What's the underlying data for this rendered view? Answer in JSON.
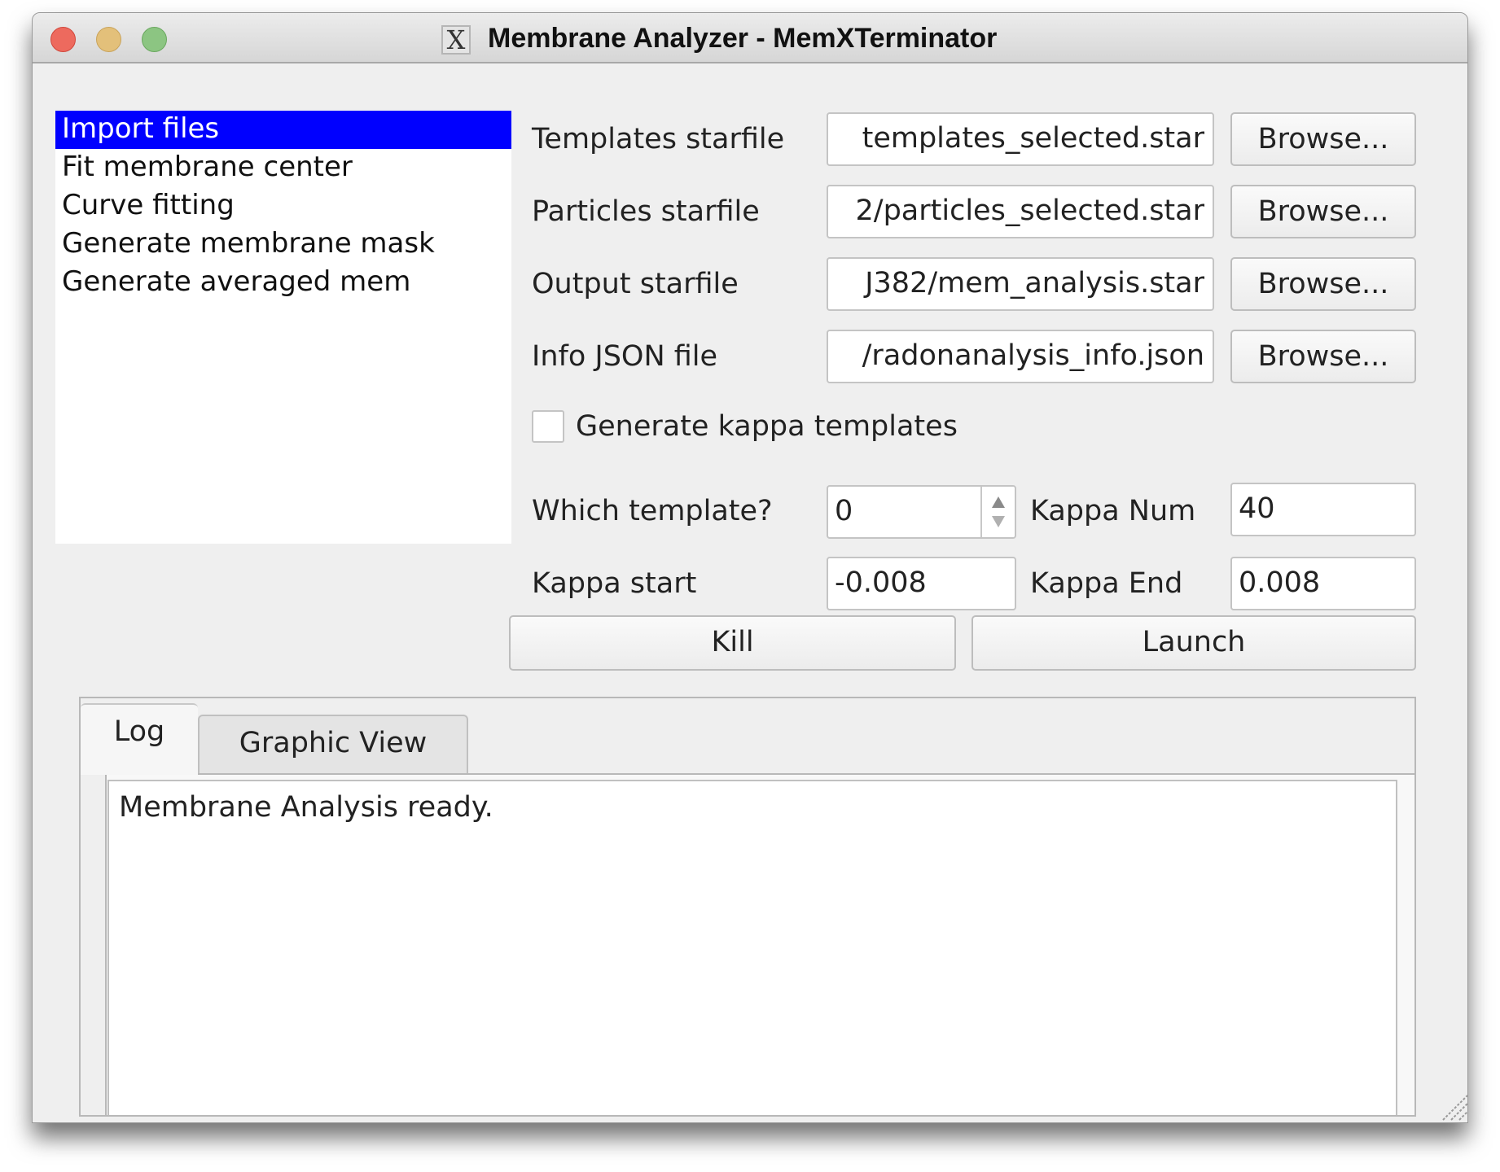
{
  "window": {
    "title": "Membrane Analyzer - MemXTerminator",
    "app_icon": "x11-icon",
    "controls": [
      "close",
      "minimize",
      "maximize"
    ]
  },
  "steps": {
    "items": [
      {
        "label": "Import files",
        "selected": true
      },
      {
        "label": "Fit membrane center",
        "selected": false
      },
      {
        "label": "Curve fitting",
        "selected": false
      },
      {
        "label": "Generate membrane mask",
        "selected": false
      },
      {
        "label": "Generate averaged mem",
        "selected": false
      }
    ]
  },
  "form": {
    "file_rows": [
      {
        "label": "Templates starfile",
        "value": "templates_selected.star",
        "button": "Browse..."
      },
      {
        "label": "Particles starfile",
        "value": "2/particles_selected.star",
        "button": "Browse..."
      },
      {
        "label": "Output starfile",
        "value": "J382/mem_analysis.star",
        "button": "Browse..."
      },
      {
        "label": "Info JSON file",
        "value": "/radonanalysis_info.json",
        "button": "Browse..."
      }
    ],
    "generate_kappa": {
      "label": "Generate kappa templates",
      "checked": false
    },
    "which_template": {
      "label": "Which template?",
      "value": "0"
    },
    "kappa_num": {
      "label": "Kappa Num",
      "value": "40"
    },
    "kappa_start": {
      "label": "Kappa start",
      "value": "-0.008"
    },
    "kappa_end": {
      "label": "Kappa End",
      "value": "0.008"
    },
    "kill_label": "Kill",
    "launch_label": "Launch"
  },
  "output": {
    "tabs": [
      {
        "label": "Log",
        "active": true
      },
      {
        "label": "Graphic View",
        "active": false
      }
    ],
    "log_text": "Membrane Analysis ready."
  }
}
